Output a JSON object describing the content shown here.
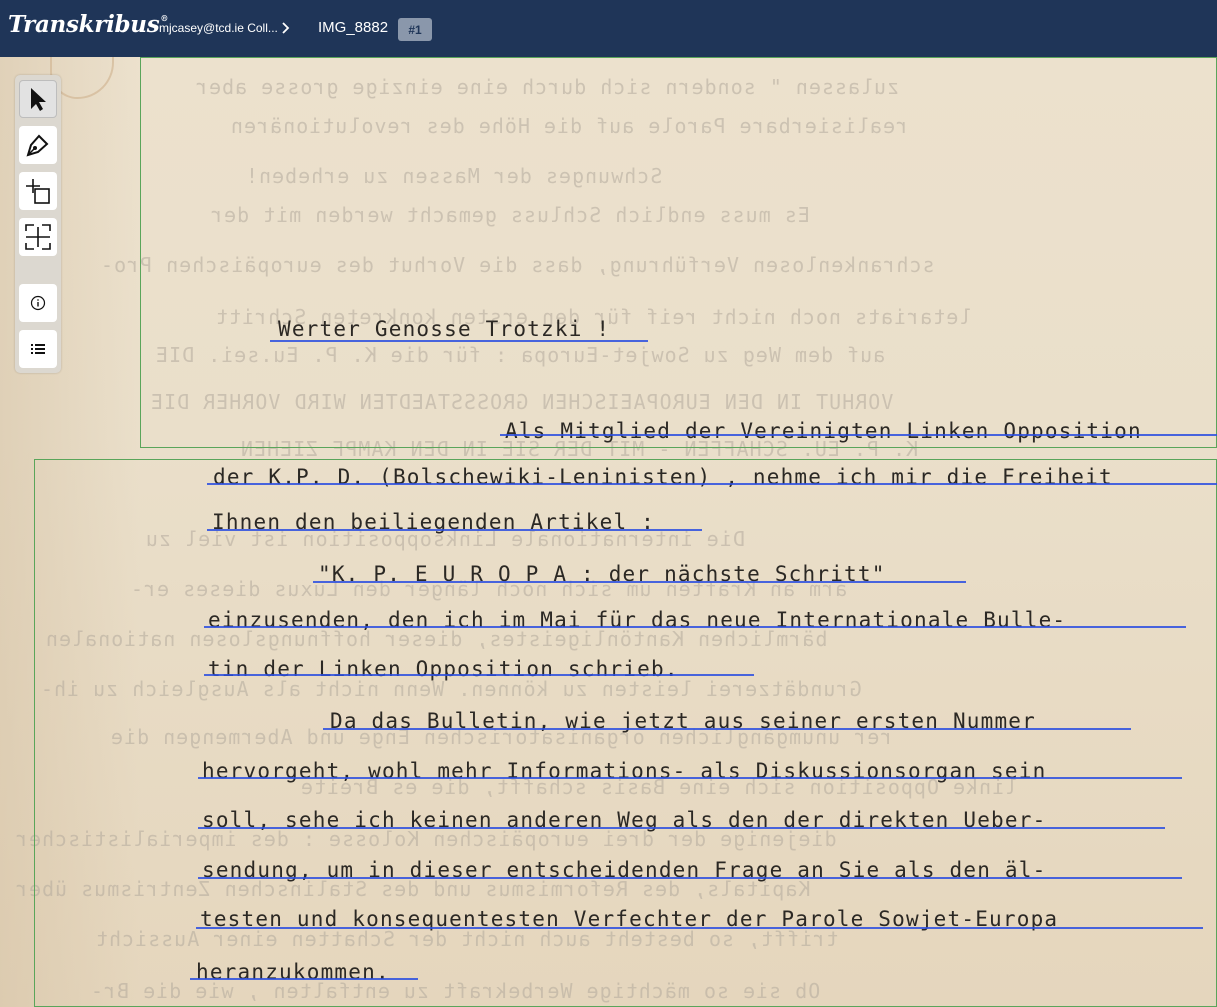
{
  "header": {
    "logo": "Transkribus",
    "logo_mark": "®",
    "breadcrumb": "mjcasey@tcd.ie Coll...",
    "document_name": "IMG_8882",
    "page_badge": "#1"
  },
  "toolbar": {
    "tools": [
      {
        "icon": "cursor-icon",
        "name": "select"
      },
      {
        "icon": "pen-icon",
        "name": "draw"
      },
      {
        "icon": "add-region-icon",
        "name": "add-region"
      },
      {
        "icon": "split-region-icon",
        "name": "split-region"
      },
      {
        "icon": "info-icon",
        "name": "info"
      },
      {
        "icon": "list-icon",
        "name": "list"
      }
    ]
  },
  "document": {
    "lines": [
      "Werter Genosse Trotzki !",
      "Als Mitglied  der Vereinigten Linken Opposition",
      "der K.P. D. (Bolschewiki-Leninisten) , nehme ich mir die Freiheit",
      "Ihnen den beiliegenden Artikel :",
      "\"K. P. E U R O P A  : der nächste Schritt\"",
      "einzusenden, den ich im Mai  für das neue Internationale Bulle-",
      "tin der Linken Opposition  schrieb.",
      "Da das Bulletin, wie jetzt aus seiner ersten Nummer",
      "hervorgeht, wohl mehr Informations- als Diskussionsorgan  sein",
      "soll, sehe ich keinen anderen Weg als den der direkten Ueber-",
      "sendung, um in dieser entscheidenden Frage  an Sie als den äl-",
      "testen und konsequentesten Verfechter  der Parole Sowjet-Europa",
      "heranzukommen."
    ],
    "bleed_through": [
      "zulassen \" sondern sich durch eine einzige grosse aber",
      "realisierbare Parole auf die Höhe des revolutionären",
      "Schwunges der Massen zu erheben!",
      "Es muss endlich Schluss gemacht werden mit der",
      "schrankenlosen Verführung, dass die Vorhut des europäischen Pro-",
      "letariats noch nicht reif für den ersten konkreten Schritt",
      "auf dem Weg zu Sowjet-Europa : für die K. P. Eu.sei.  DIE",
      "VORHUT IN DEN EUROPAEISCHEN GROSSSTAEDTEN WIRD VORHER DIE",
      "K. P. EU. SCHAFFEN - MIT DER SIE IN DEN KAMPF ZIEHEN",
      "Die internationale Linksopposition ist viel zu",
      "arm an Kräften um sich noch länger den Luxus dieses er-",
      "bärmlichen Kantönligeistes, dieser hoffnungslosen nationalen",
      "Grundätzerei leisten zu können. Wenn nicht als Ausgleich zu ih-",
      "rer unumgänglichen organisatorischen Enge und Abermengen die",
      "linke Opposition sich eine Basis schafft, die es Breite",
      "diejenige der drei europäischen Kolosse : des imperialistischer",
      "Kapitals, des Reformismus und des Stalinschen Zentrismus über",
      "trifft, so besteht auch nicht der Schatten einer Aussicht",
      "Ob sie so mächtige Werbekraft zu entfalten , wie die Br-"
    ]
  }
}
